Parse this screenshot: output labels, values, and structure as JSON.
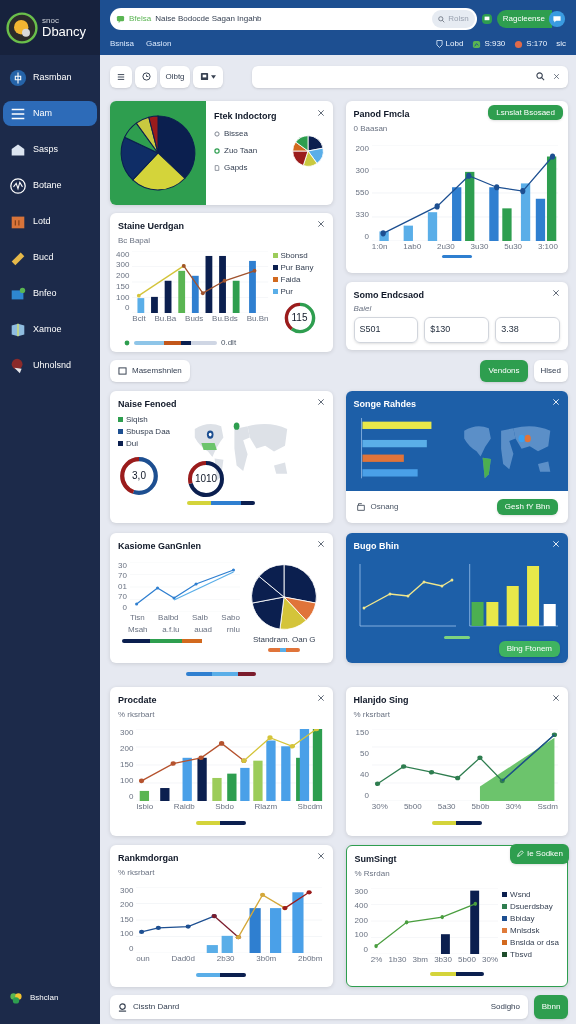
{
  "app": {
    "tagline": "snoc",
    "name": "Dbancy"
  },
  "header": {
    "search_badge": "Bfelsa",
    "search_text": "Naise Bodocde Sagan Ingahb",
    "search_button": "Rolsn",
    "action_button": "Ragcleense",
    "nav": [
      "Bsnisa",
      "Gasion"
    ],
    "stats": [
      {
        "kind": "shield",
        "label": "Lobd"
      },
      {
        "kind": "chart",
        "label": "S:930"
      },
      {
        "kind": "dot",
        "label": "S:170"
      },
      {
        "kind": "plain",
        "label": "sic"
      }
    ]
  },
  "sidebar": {
    "items": [
      {
        "kind": "logo",
        "label": "Rasmban",
        "selected": false
      },
      {
        "kind": "list",
        "label": "Nam",
        "selected": true
      },
      {
        "kind": "house",
        "label": "Sasps",
        "selected": false
      },
      {
        "kind": "wave",
        "label": "Botane",
        "selected": false
      },
      {
        "kind": "crate",
        "label": "Lotd",
        "selected": false
      },
      {
        "kind": "bar",
        "label": "Bucd",
        "selected": false
      },
      {
        "kind": "card",
        "label": "Bnfeo",
        "selected": false
      },
      {
        "kind": "cube",
        "label": "Xamoe",
        "selected": false
      },
      {
        "kind": "figure",
        "label": "Uhnolsnd",
        "selected": false
      }
    ],
    "footer": "Bshclan"
  },
  "toolbar": {
    "text_button": "Olbtg"
  },
  "top_left": [
    {
      "kind": "pie_legend",
      "title": "Ftek Indoctorg",
      "legend": [
        {
          "kind": "ring",
          "label": "Bissea"
        },
        {
          "kind": "dot",
          "label": "Zuo Taan"
        },
        {
          "kind": "page",
          "label": "Gapds"
        }
      ]
    },
    {
      "kind": "combo",
      "title": "Staine Uerdgan",
      "subtitle": "Bc Bapal",
      "y_ticks": [
        "400",
        "300",
        "200",
        "150",
        "100",
        "0"
      ],
      "x_ticks": [
        "Bclt",
        "Bu.Ba",
        "Buds",
        "Bu.Bds",
        "Bu.Bn"
      ],
      "legend": [
        {
          "label": "Sbonsd",
          "color": "#9ccc5a"
        },
        {
          "label": "Pur Bany",
          "color": "#0b1f4f"
        },
        {
          "label": "Faida",
          "color": "#d2691e"
        },
        {
          "label": "Pur",
          "color": "#5aaee8"
        }
      ],
      "gauge": "115",
      "footer": "0.dlt"
    }
  ],
  "top_right": [
    {
      "kind": "bar_line",
      "title": "Panod Fmcla",
      "subtitle": "0 Baasan",
      "button": "Lsnslat Bsosaed",
      "y_ticks": [
        "200",
        "300",
        "550",
        "330",
        "0"
      ],
      "x_ticks": [
        "1:0n",
        "1ab0",
        "2u30",
        "3u30",
        "5u30",
        "3:100"
      ]
    },
    {
      "kind": "stats",
      "title": "Somo Endcsaod",
      "subtitle": "Baiel",
      "values": [
        "S501",
        "$130",
        "3.38"
      ]
    }
  ],
  "actions": {
    "left": "Masemshnlen",
    "primary": "Vendons",
    "secondary": "Hlsed"
  },
  "grid_upper": [
    {
      "kind": "map_gauges",
      "title": "Naise Fenoed",
      "legend": [
        {
          "label": "Siqish",
          "color": "#2e9e4f"
        },
        {
          "label": "Sbuspa Daa",
          "color": "#1d4f91"
        },
        {
          "label": "Dui",
          "color": "#0b1f4f"
        }
      ],
      "gauges": [
        "3,0",
        "1010"
      ]
    },
    {
      "kind": "blue_bars_map",
      "title": "Songe Rahdes",
      "footer": "Osnang",
      "button": "Gesh fY Bhn"
    },
    {
      "kind": "line_pie",
      "title": "Kasiome GanGnlen",
      "y_ticks": [
        "30",
        "70",
        "01",
        "70",
        "0"
      ],
      "x_ticks": [
        "Tisn",
        "Balbd",
        "Salb",
        "Sabo"
      ],
      "x_ticks_2": [
        "Msah",
        "a.f.lu",
        "auad",
        "rnlu"
      ],
      "caption": "Standram. Oan G"
    },
    {
      "kind": "blue_line_bars",
      "title": "Bugo Bhin",
      "button": "Blng Ftonem"
    }
  ],
  "grid_lower": [
    {
      "kind": "combo2",
      "title": "Procdate",
      "subtitle": "% rksrbart",
      "y_ticks": [
        "300",
        "200",
        "150",
        "100",
        "0"
      ],
      "x_ticks": [
        "Isbio",
        "Raldb",
        "Sbdo",
        "Rlazm",
        "Sbcdm"
      ]
    },
    {
      "kind": "area",
      "title": "Hlanjdo Sing",
      "subtitle": "% rksrbart",
      "y_ticks": [
        "150",
        "50",
        "40",
        "0"
      ],
      "x_ticks": [
        "30%",
        "5b00",
        "5a30",
        "5b0b",
        "30%",
        "Ssdm"
      ]
    },
    {
      "kind": "bars_line",
      "title": "Rankmdorgan",
      "subtitle": "% rksrbart",
      "y_ticks": [
        "300",
        "200",
        "150",
        "100",
        "0"
      ],
      "x_ticks": [
        "oun",
        "Dad0d",
        "2b30",
        "3b0m",
        "2b0bm"
      ]
    },
    {
      "kind": "legend_chart",
      "title": "SumSingt",
      "subtitle": "% Rsrdan",
      "button": "Ie Sodken",
      "y_ticks": [
        "300",
        "400",
        "200",
        "100",
        "0"
      ],
      "x_ticks": [
        "2%",
        "1b30",
        "3bm",
        "3b30",
        "5b00",
        "30%"
      ],
      "legend": [
        {
          "label": "Wsnd",
          "color": "#0b1f4f"
        },
        {
          "label": "Dsuerdsbay",
          "color": "#2e7d4f"
        },
        {
          "label": "Bbiday",
          "color": "#1d4f91"
        },
        {
          "label": "Mnlsdsk",
          "color": "#e07b3a"
        },
        {
          "label": "Bnslda or dsa",
          "color": "#d2691e"
        },
        {
          "label": "Tbsvd",
          "color": "#1e4d2b"
        }
      ]
    }
  ],
  "bottom_bar": {
    "text": "Cisstn Danrd",
    "right_text": "Sodigho",
    "button": "Bbnn"
  }
}
